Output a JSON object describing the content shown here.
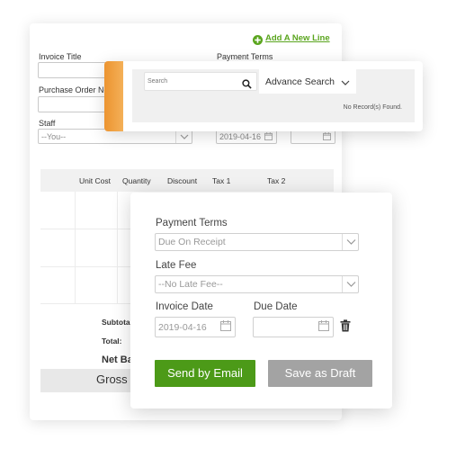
{
  "invoice": {
    "add_line_label": "Add A New Line",
    "invoice_title_label": "Invoice Title",
    "payment_terms_label": "Payment Terms",
    "po_label": "Purchase Order No",
    "staff_label": "Staff",
    "staff_value": "--You--",
    "date_value": "2019-04-16",
    "columns": [
      "Unit Cost",
      "Quantity",
      "Discount",
      "Tax 1",
      "Tax 2"
    ],
    "subtotal_label": "Subtota",
    "total_label": "Total:",
    "net_label": "Net Ba",
    "gross_label": "Gross"
  },
  "search": {
    "placeholder": "Search",
    "advanced_label": "Advance Search",
    "empty_message": "No Record(s) Found."
  },
  "panel": {
    "payment_terms_label": "Payment Terms",
    "payment_terms_value": "Due On Receipt",
    "late_fee_label": "Late Fee",
    "late_fee_value": "--No Late Fee--",
    "invoice_date_label": "Invoice Date",
    "invoice_date_value": "2019-04-16",
    "due_date_label": "Due Date",
    "due_date_value": "",
    "send_email_label": "Send by Email",
    "save_draft_label": "Save as Draft"
  },
  "colors": {
    "accent_green": "#4c9a18",
    "link_green": "#5aa51e",
    "orange_tab": "#f0a03c",
    "draft_gray": "#a3a3a3"
  }
}
